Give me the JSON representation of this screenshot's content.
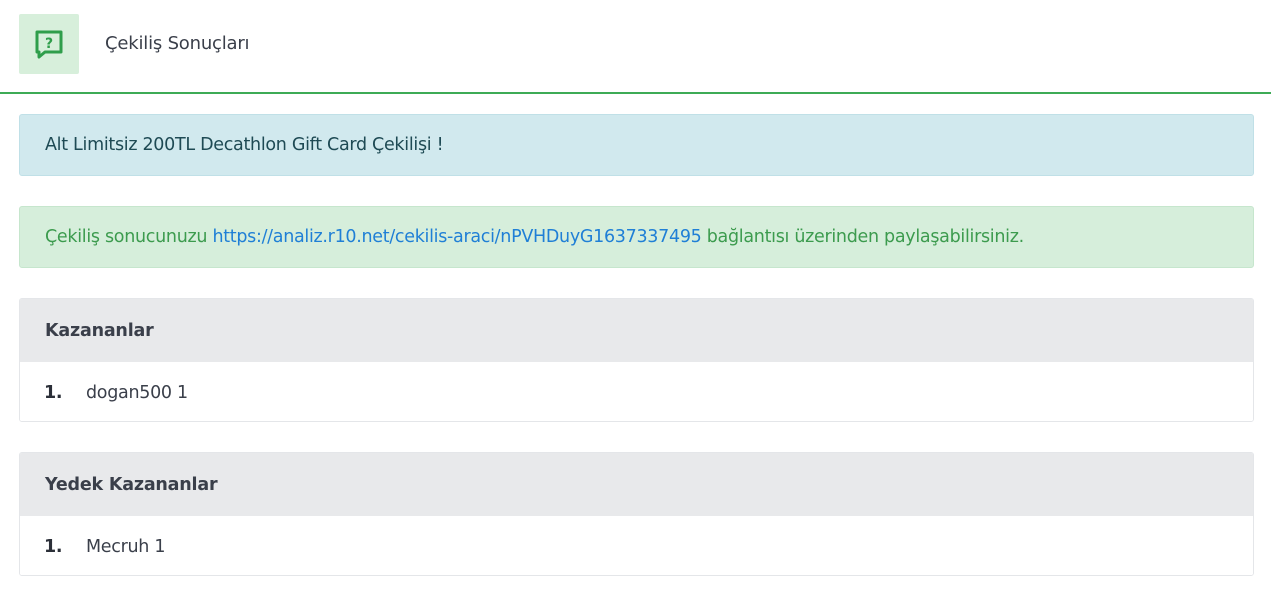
{
  "header": {
    "icon": "question-chat-icon",
    "title": "Çekiliş Sonuçları",
    "accent_color": "#3dab56"
  },
  "info_alert": {
    "text": "Alt Limitsiz 200TL Decathlon Gift Card Çekilişi !"
  },
  "share_alert": {
    "prefix": "Çekiliş sonucunuzu ",
    "link": "https://analiz.r10.net/cekilis-araci/nPVHDuyG1637337495",
    "suffix": " bağlantısı üzerinden paylaşabilirsiniz."
  },
  "winners": {
    "title": "Kazananlar",
    "items": [
      {
        "rank": "1.",
        "name": "dogan500 1"
      }
    ]
  },
  "backup_winners": {
    "title": "Yedek Kazananlar",
    "items": [
      {
        "rank": "1.",
        "name": "Mecruh 1"
      }
    ]
  }
}
